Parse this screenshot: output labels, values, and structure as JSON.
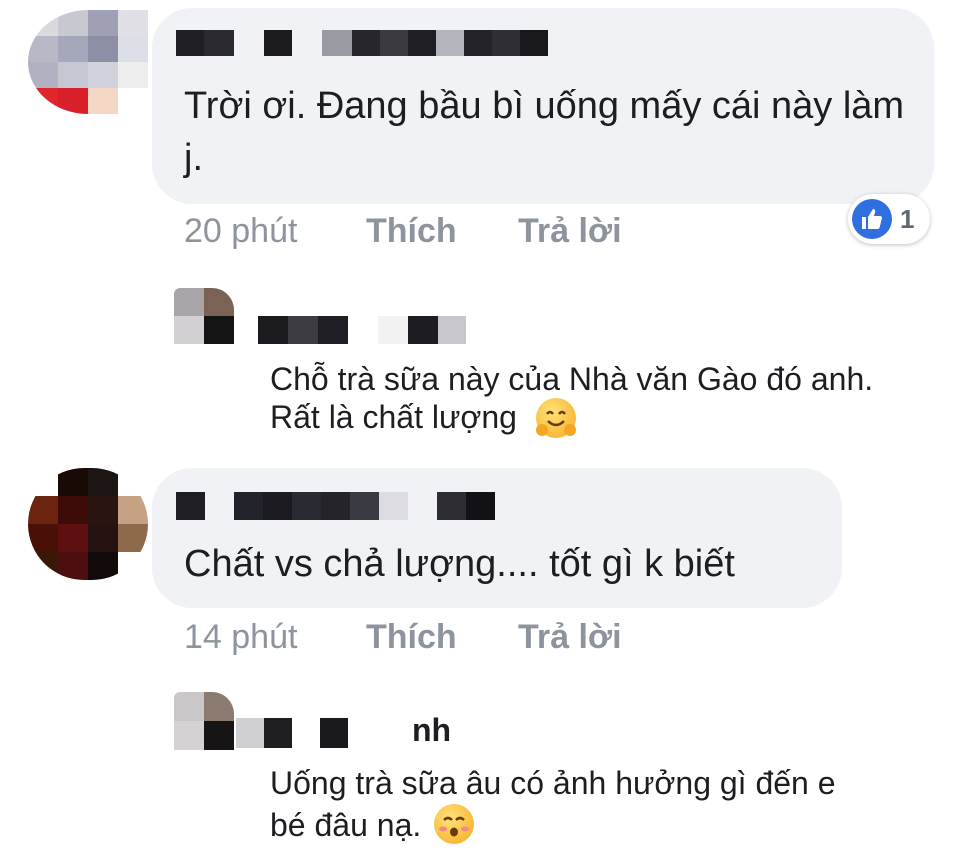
{
  "comments": [
    {
      "text": "Trời ơi. Đang bầu bì uống mấy cái này làm j.",
      "time": "20 phút",
      "like_label": "Thích",
      "reply_label": "Trả lời",
      "reaction": {
        "icon": "like-icon",
        "count": "1"
      },
      "reply": {
        "text_line1": "Chỗ trà sữa này của Nhà văn Gào đó anh.",
        "text_line2": "Rất là chất lượng",
        "emoji": "hugging-face-emoji"
      }
    },
    {
      "text": "Chất vs chả lượng.... tốt gì k biết",
      "time": "14 phút",
      "like_label": "Thích",
      "reply_label": "Trả lời",
      "reply": {
        "name_fragment": "nh",
        "text_line1": "Uống trà sữa âu có  ảnh hưởng gì đến e",
        "text_line2": "bé đâu nạ.",
        "emoji": "kissing-face-emoji"
      }
    }
  ],
  "colors": {
    "bubble": "#f1f2f6",
    "meta_text": "#8d949e",
    "like_blue": "#2f6fe0"
  }
}
